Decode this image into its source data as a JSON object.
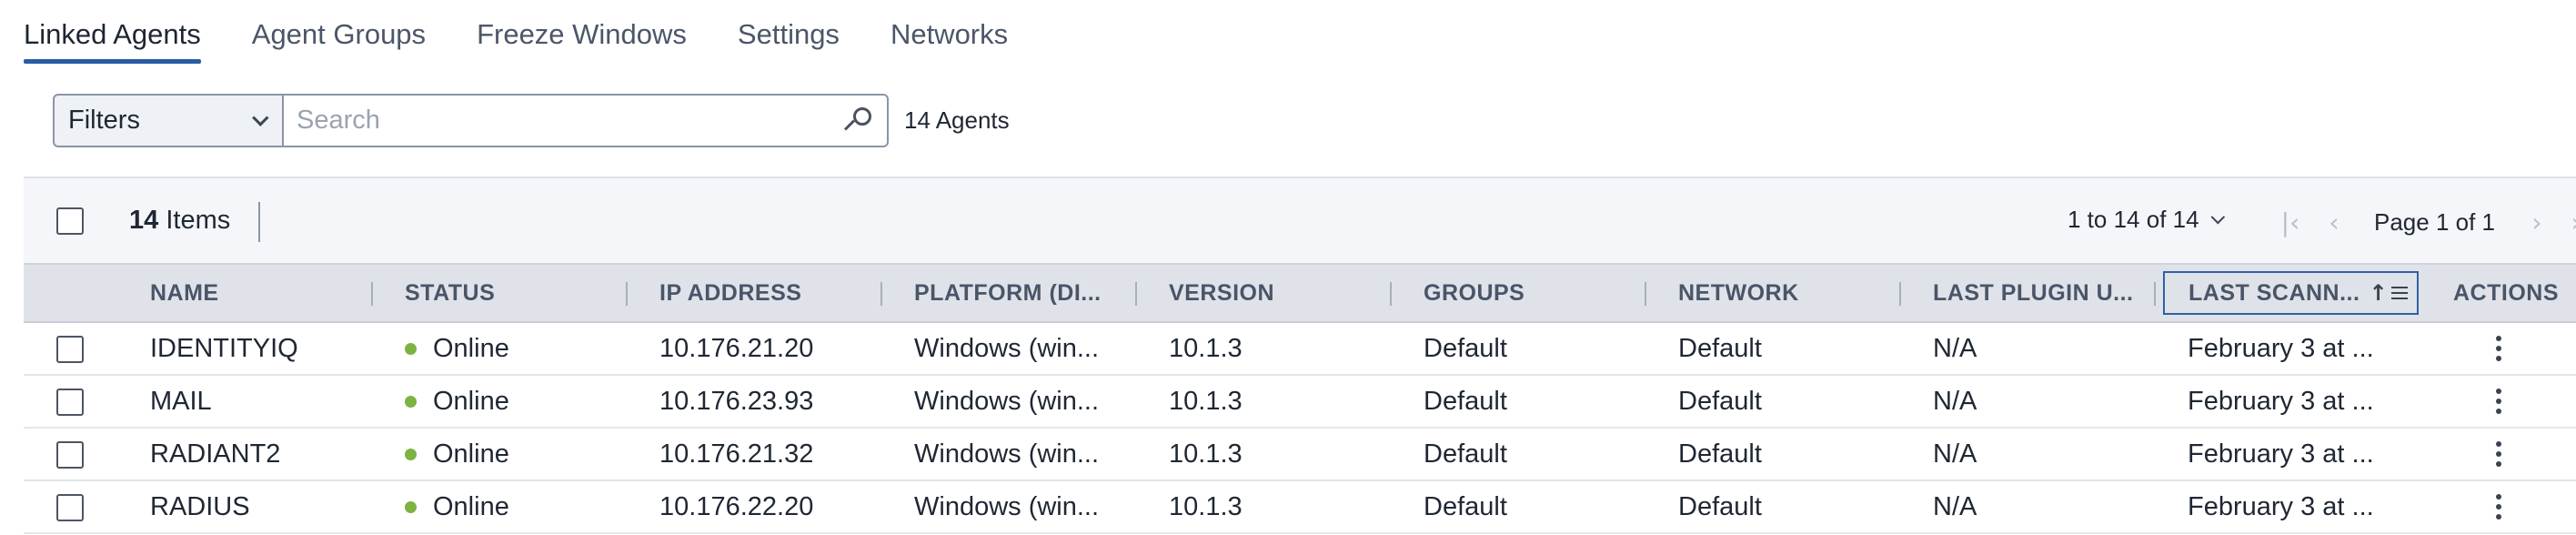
{
  "tabs": [
    {
      "label": "Linked Agents",
      "active": true
    },
    {
      "label": "Agent Groups",
      "active": false
    },
    {
      "label": "Freeze Windows",
      "active": false
    },
    {
      "label": "Settings",
      "active": false
    },
    {
      "label": "Networks",
      "active": false
    }
  ],
  "filters": {
    "select_label": "Filters",
    "search_placeholder": "Search",
    "agent_count": "14 Agents"
  },
  "toolbar": {
    "items_count": "14",
    "items_label": "Items",
    "range_label": "1 to 14 of 14",
    "page_label": "Page 1 of 1"
  },
  "table": {
    "columns": [
      {
        "label": "NAME"
      },
      {
        "label": "STATUS"
      },
      {
        "label": "IP ADDRESS"
      },
      {
        "label": "PLATFORM (DI..."
      },
      {
        "label": "VERSION"
      },
      {
        "label": "GROUPS"
      },
      {
        "label": "NETWORK"
      },
      {
        "label": "LAST PLUGIN U..."
      },
      {
        "label": "LAST SCANN...",
        "sorted": "ascending"
      },
      {
        "label": "ACTIONS"
      }
    ],
    "rows": [
      {
        "name": "IDENTITYIQ",
        "status": "Online",
        "ip": "10.176.21.20",
        "platform": "Windows (win...",
        "version": "10.1.3",
        "groups": "Default",
        "network": "Default",
        "last_plugin": "N/A",
        "last_scan": "February 3 at ..."
      },
      {
        "name": "MAIL",
        "status": "Online",
        "ip": "10.176.23.93",
        "platform": "Windows (win...",
        "version": "10.1.3",
        "groups": "Default",
        "network": "Default",
        "last_plugin": "N/A",
        "last_scan": "February 3 at ..."
      },
      {
        "name": "RADIANT2",
        "status": "Online",
        "ip": "10.176.21.32",
        "platform": "Windows (win...",
        "version": "10.1.3",
        "groups": "Default",
        "network": "Default",
        "last_plugin": "N/A",
        "last_scan": "February 3 at ..."
      },
      {
        "name": "RADIUS",
        "status": "Online",
        "ip": "10.176.22.20",
        "platform": "Windows (win...",
        "version": "10.1.3",
        "groups": "Default",
        "network": "Default",
        "last_plugin": "N/A",
        "last_scan": "February 3 at ..."
      }
    ]
  },
  "colors": {
    "accent": "#2a5ba6",
    "status_online": "#7cb342",
    "header_bg": "#dfe3e9",
    "toolbar_bg": "#f4f6f9"
  },
  "icons": {
    "search": "search-icon",
    "dropdown": "chevron-down-icon",
    "first_page": "first-page-icon",
    "prev_page": "prev-page-icon",
    "next_page": "next-page-icon",
    "last_page": "last-page-icon",
    "sort": "sort-ascending-icon",
    "column_menu": "column-menu-icon",
    "row_actions": "kebab-menu-icon"
  }
}
